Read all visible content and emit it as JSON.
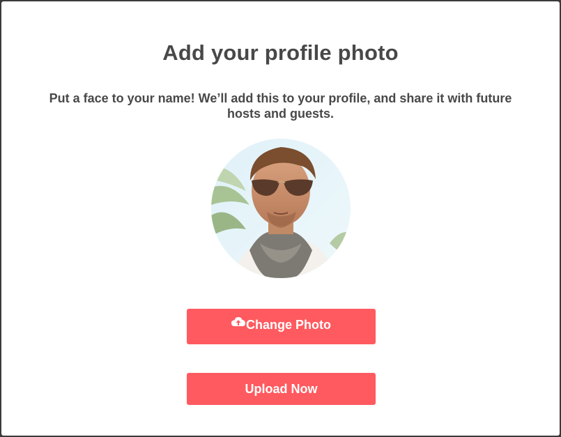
{
  "modal": {
    "title": "Add your profile photo",
    "subtitle": "Put a face to your name! We’ll add this to your profile, and share it with future hosts and guests."
  },
  "avatar": {
    "alt": "Profile photo"
  },
  "buttons": {
    "change_photo_label": "Change Photo",
    "upload_now_label": "Upload Now"
  },
  "colors": {
    "accent": "#ff5a5f",
    "text": "#484848",
    "background": "#ffffff"
  },
  "icons": {
    "change_photo": "cloud-upload-icon"
  }
}
